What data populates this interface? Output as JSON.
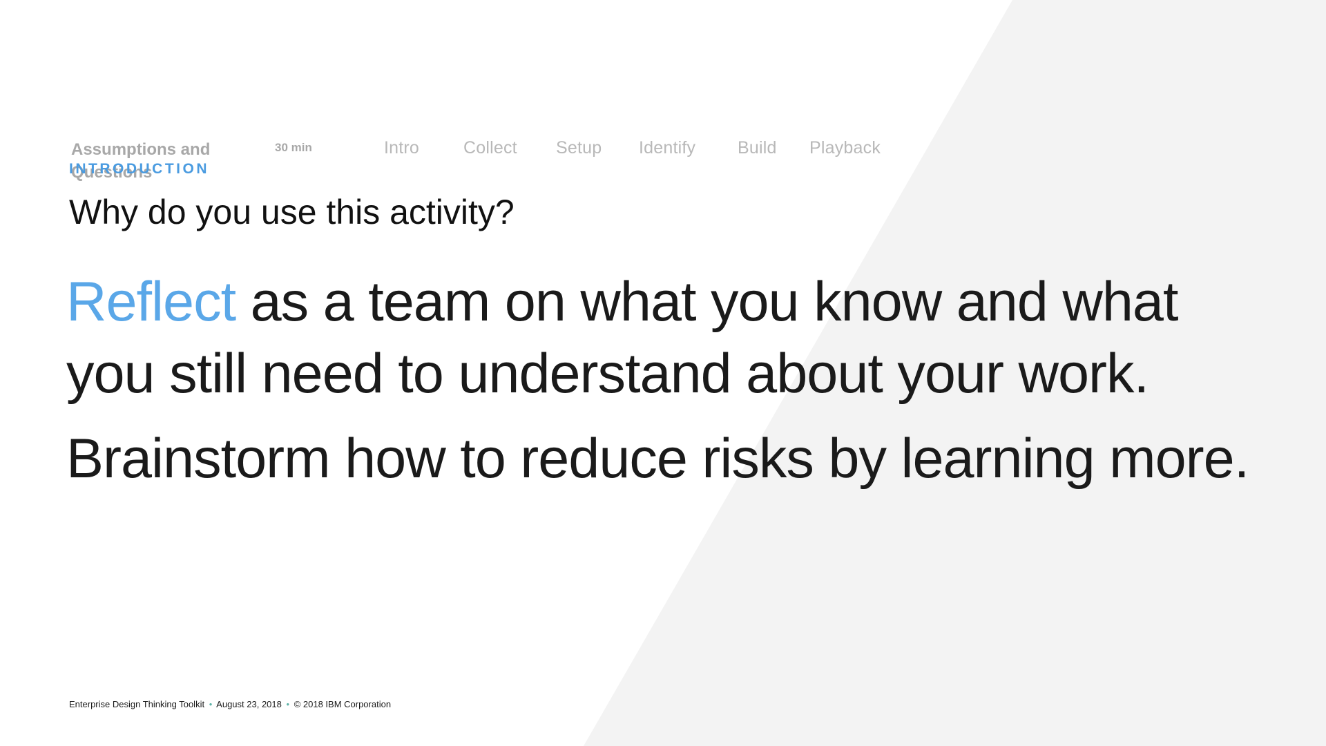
{
  "background": {
    "base_color": "#ffffff",
    "shape_color": "#f3f3f3"
  },
  "header": {
    "activity_title": "Assumptions and Questions",
    "duration": "30 min",
    "nav_items": [
      {
        "label": "Intro"
      },
      {
        "label": "Collect"
      },
      {
        "label": "Setup"
      },
      {
        "label": "Identify"
      },
      {
        "label": "Build"
      },
      {
        "label": "Playback"
      }
    ]
  },
  "main": {
    "eyebrow": "INTRODUCTION",
    "question": "Why do you use this activity?",
    "statement_accent": "Reflect",
    "statement_rest": " as a team on what you know and what you still need to understand about your work.",
    "statement_2": "Brainstorm how to reduce risks by learning more.",
    "accent_color": "#5aa7e8"
  },
  "footer": {
    "toolkit": "Enterprise Design Thinking Toolkit",
    "separator": "•",
    "date": "August 23, 2018",
    "copyright": "© 2018 IBM Corporation"
  }
}
